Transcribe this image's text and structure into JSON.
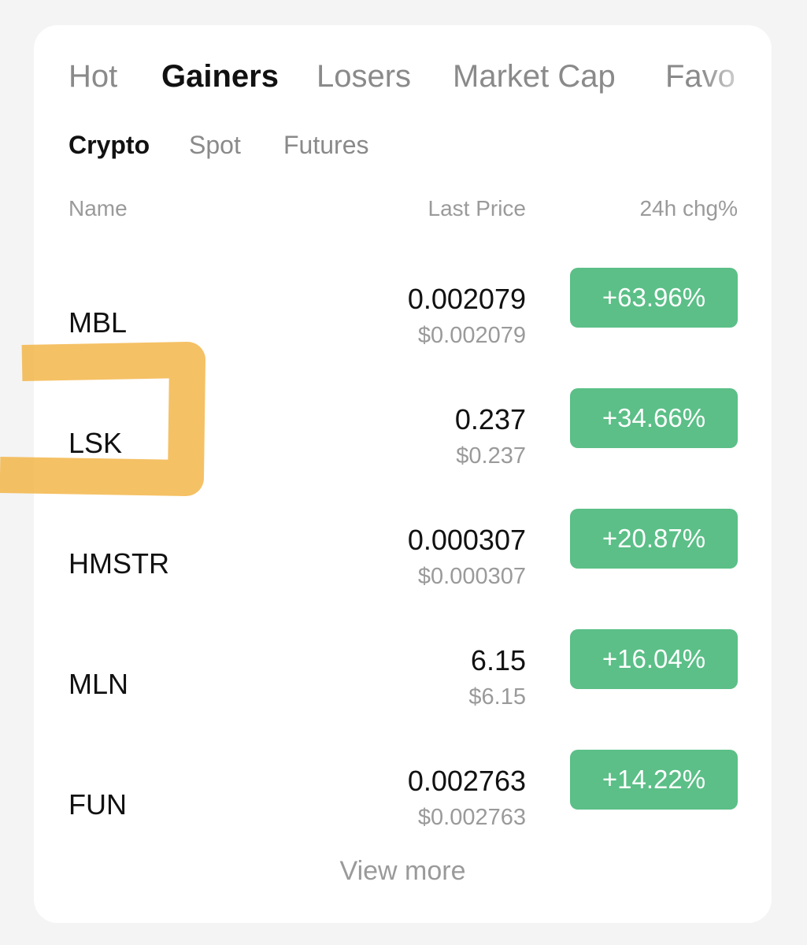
{
  "tabs": [
    "Hot",
    "Gainers",
    "Losers",
    "Market Cap",
    "Favo"
  ],
  "subtabs": [
    "Crypto",
    "Spot",
    "Futures"
  ],
  "columns": {
    "name": "Name",
    "last_price": "Last Price",
    "change": "24h chg%"
  },
  "rows": [
    {
      "symbol": "MBL",
      "price": "0.002079",
      "usd": "$0.002079",
      "change": "+63.96%"
    },
    {
      "symbol": "LSK",
      "price": "0.237",
      "usd": "$0.237",
      "change": "+34.66%"
    },
    {
      "symbol": "HMSTR",
      "price": "0.000307",
      "usd": "$0.000307",
      "change": "+20.87%"
    },
    {
      "symbol": "MLN",
      "price": "6.15",
      "usd": "$6.15",
      "change": "+16.04%"
    },
    {
      "symbol": "FUN",
      "price": "0.002763",
      "usd": "$0.002763",
      "change": "+14.22%"
    }
  ],
  "view_more": "View more",
  "colors": {
    "gain": "#5bbf87",
    "highlight": "#f2b23e",
    "background": "#f4f4f4",
    "card": "#ffffff"
  }
}
